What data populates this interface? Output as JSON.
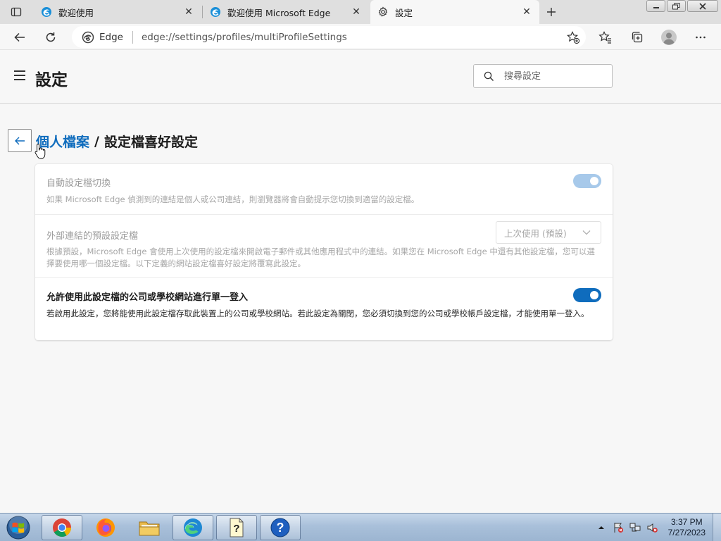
{
  "browser": {
    "tabs": [
      {
        "title": "歡迎使用",
        "active": false
      },
      {
        "title": "歡迎使用 Microsoft Edge",
        "active": false
      },
      {
        "title": "設定",
        "active": true
      }
    ],
    "omnibox": {
      "site_label": "Edge",
      "url": "edge://settings/profiles/multiProfileSettings"
    }
  },
  "settings": {
    "title": "設定",
    "search_placeholder": "搜尋設定",
    "breadcrumb": {
      "parent": "個人檔案",
      "separator": "/",
      "current": "設定檔喜好設定"
    },
    "rows": [
      {
        "title": "自動設定檔切換",
        "description": "如果 Microsoft Edge 偵測到的連結是個人或公司連結，則瀏覽器將會自動提示您切換到適當的設定檔。",
        "control": "toggle",
        "enabled": true,
        "disabled": true
      },
      {
        "title": "外部連結的預設設定檔",
        "description": "根據預設，Microsoft Edge 會使用上次使用的設定檔來開啟電子郵件或其他應用程式中的連結。如果您在 Microsoft Edge 中還有其他設定檔，您可以選擇要使用哪一個設定檔。以下定義的網站設定檔喜好設定將覆寫此設定。",
        "control": "select",
        "selected": "上次使用 (預設)",
        "disabled": true
      },
      {
        "title": "允許使用此設定檔的公司或學校網站進行單一登入",
        "description": "若啟用此設定，您將能使用此設定檔存取此裝置上的公司或學校網站。若此設定為關閉，您必須切換到您的公司或學校帳戶設定檔，才能使用單一登入。",
        "control": "toggle",
        "enabled": true,
        "disabled": false
      }
    ]
  },
  "taskbar": {
    "apps": [
      "chrome-icon",
      "firefox-icon",
      "file-explorer-icon",
      "edge-icon",
      "help-file-icon",
      "help-icon"
    ],
    "clock": {
      "time": "3:37 PM",
      "date": "7/27/2023"
    }
  },
  "colors": {
    "accent": "#0f6cbd",
    "toggle_disabled": "#a7c9ea"
  }
}
